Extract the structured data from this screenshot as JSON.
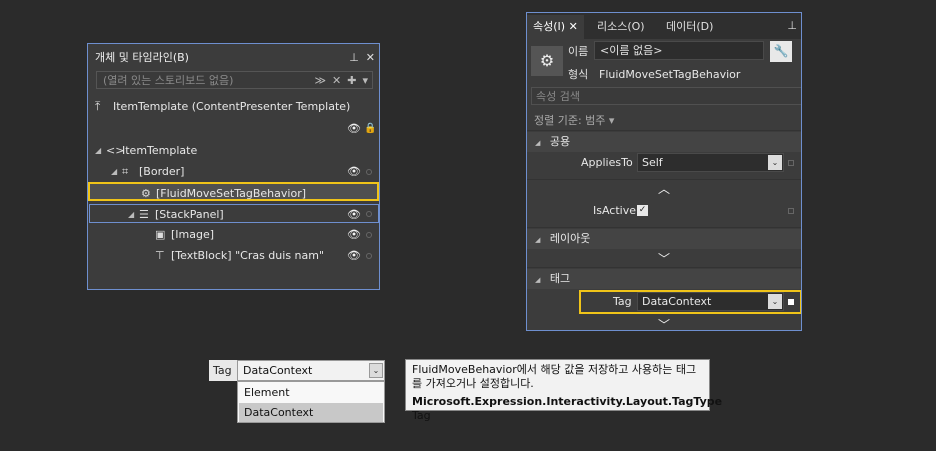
{
  "objects_panel": {
    "title": "개체 및 타임라인(B)",
    "pin_glyph": "ᴾ",
    "close_glyph": "✕",
    "storyboard_placeholder": "(열려 있는 스토리보드 없음)",
    "template_header": "ItemTemplate (ContentPresenter Template)",
    "tree": [
      {
        "label": "ItemTemplate",
        "icon": "code-brackets-icon"
      },
      {
        "label": "[Border]",
        "icon": "border-icon"
      },
      {
        "label": "[FluidMoveSetTagBehavior]",
        "icon": "gear-icon"
      },
      {
        "label": "[StackPanel]",
        "icon": "stackpanel-icon"
      },
      {
        "label": "[Image]",
        "icon": "image-icon"
      },
      {
        "label": "[TextBlock] \"Cras duis nam\"",
        "icon": "textblock-icon"
      }
    ]
  },
  "properties_panel": {
    "tabs": [
      "속성(I)",
      "리소스(O)",
      "데이터(D)"
    ],
    "name_label": "이름",
    "name_value": "<이름 없음>",
    "type_label": "형식",
    "type_value": "FluidMoveSetTagBehavior",
    "search_placeholder": "속성 검색",
    "sort_label": "정렬 기준: 범주 ▾",
    "categories": {
      "common": "공용",
      "layout": "레이아웃",
      "tag": "태그"
    },
    "applies_to_label": "AppliesTo",
    "applies_to_value": "Self",
    "is_active_label": "IsActive",
    "is_active_checked": true,
    "tag_label": "Tag",
    "tag_value": "DataContext"
  },
  "dropdown_demo": {
    "label": "Tag",
    "value": "DataContext",
    "options": [
      "Element",
      "DataContext"
    ],
    "selected": "DataContext"
  },
  "tooltip": {
    "description": "FluidMoveBehavior에서 해당 값을 저장하고 사용하는 태그를 가져오거나 설정합니다.",
    "type_name": "Microsoft.Expression.Interactivity.Layout.TagType",
    "prop_name": "Tag"
  },
  "colors": {
    "highlight": "#f0c419",
    "panel_border": "#6e8fcf",
    "background": "#2b2b2b"
  }
}
